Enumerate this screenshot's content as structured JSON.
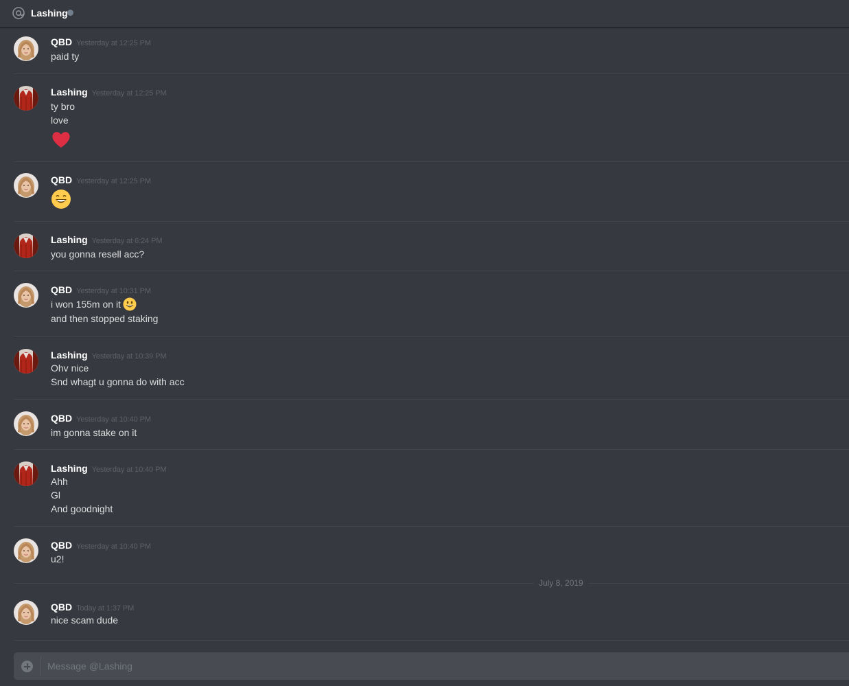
{
  "header": {
    "icon": "at-icon",
    "title": "Lashing",
    "status_color": "#747f8d"
  },
  "users": {
    "qbd": "QBD",
    "lashing": "Lashing"
  },
  "messages": [
    {
      "author": "QBD",
      "timestamp": "Yesterday at 12:25 PM",
      "lines": [
        "paid ty"
      ]
    },
    {
      "author": "Lashing",
      "timestamp": "Yesterday at 12:25 PM",
      "lines": [
        "ty bro",
        "love"
      ],
      "emoji": "heart-emoji"
    },
    {
      "author": "QBD",
      "timestamp": "Yesterday at 12:25 PM",
      "lines": [],
      "emoji": "grinning-emoji"
    },
    {
      "author": "Lashing",
      "timestamp": "Yesterday at 6:24 PM",
      "lines": [
        "you gonna resell acc?"
      ]
    },
    {
      "author": "QBD",
      "timestamp": "Yesterday at 10:31 PM",
      "lines": [
        "i won 155m on it",
        "and then stopped staking"
      ],
      "inline_emoji": "smiley-emoji"
    },
    {
      "author": "Lashing",
      "timestamp": "Yesterday at 10:39 PM",
      "lines": [
        "Ohv nice",
        "Snd whagt u gonna do with acc"
      ]
    },
    {
      "author": "QBD",
      "timestamp": "Yesterday at 10:40 PM",
      "lines": [
        "im gonna stake on it"
      ]
    },
    {
      "author": "Lashing",
      "timestamp": "Yesterday at 10:40 PM",
      "lines": [
        "Ahh",
        "Gl",
        "And goodnight"
      ]
    },
    {
      "author": "QBD",
      "timestamp": "Yesterday at 10:40 PM",
      "lines": [
        "u2!"
      ]
    },
    {
      "author": "QBD",
      "timestamp": "Today at 1:37 PM",
      "lines": [
        "nice scam dude"
      ]
    }
  ],
  "date_divider": "July 8, 2019",
  "composer": {
    "placeholder": "Message @Lashing",
    "value": ""
  },
  "colors": {
    "background": "#36393f",
    "text": "#dcddde",
    "username": "#ffffff",
    "timestamp": "rgba(255,255,255,0.2)"
  }
}
